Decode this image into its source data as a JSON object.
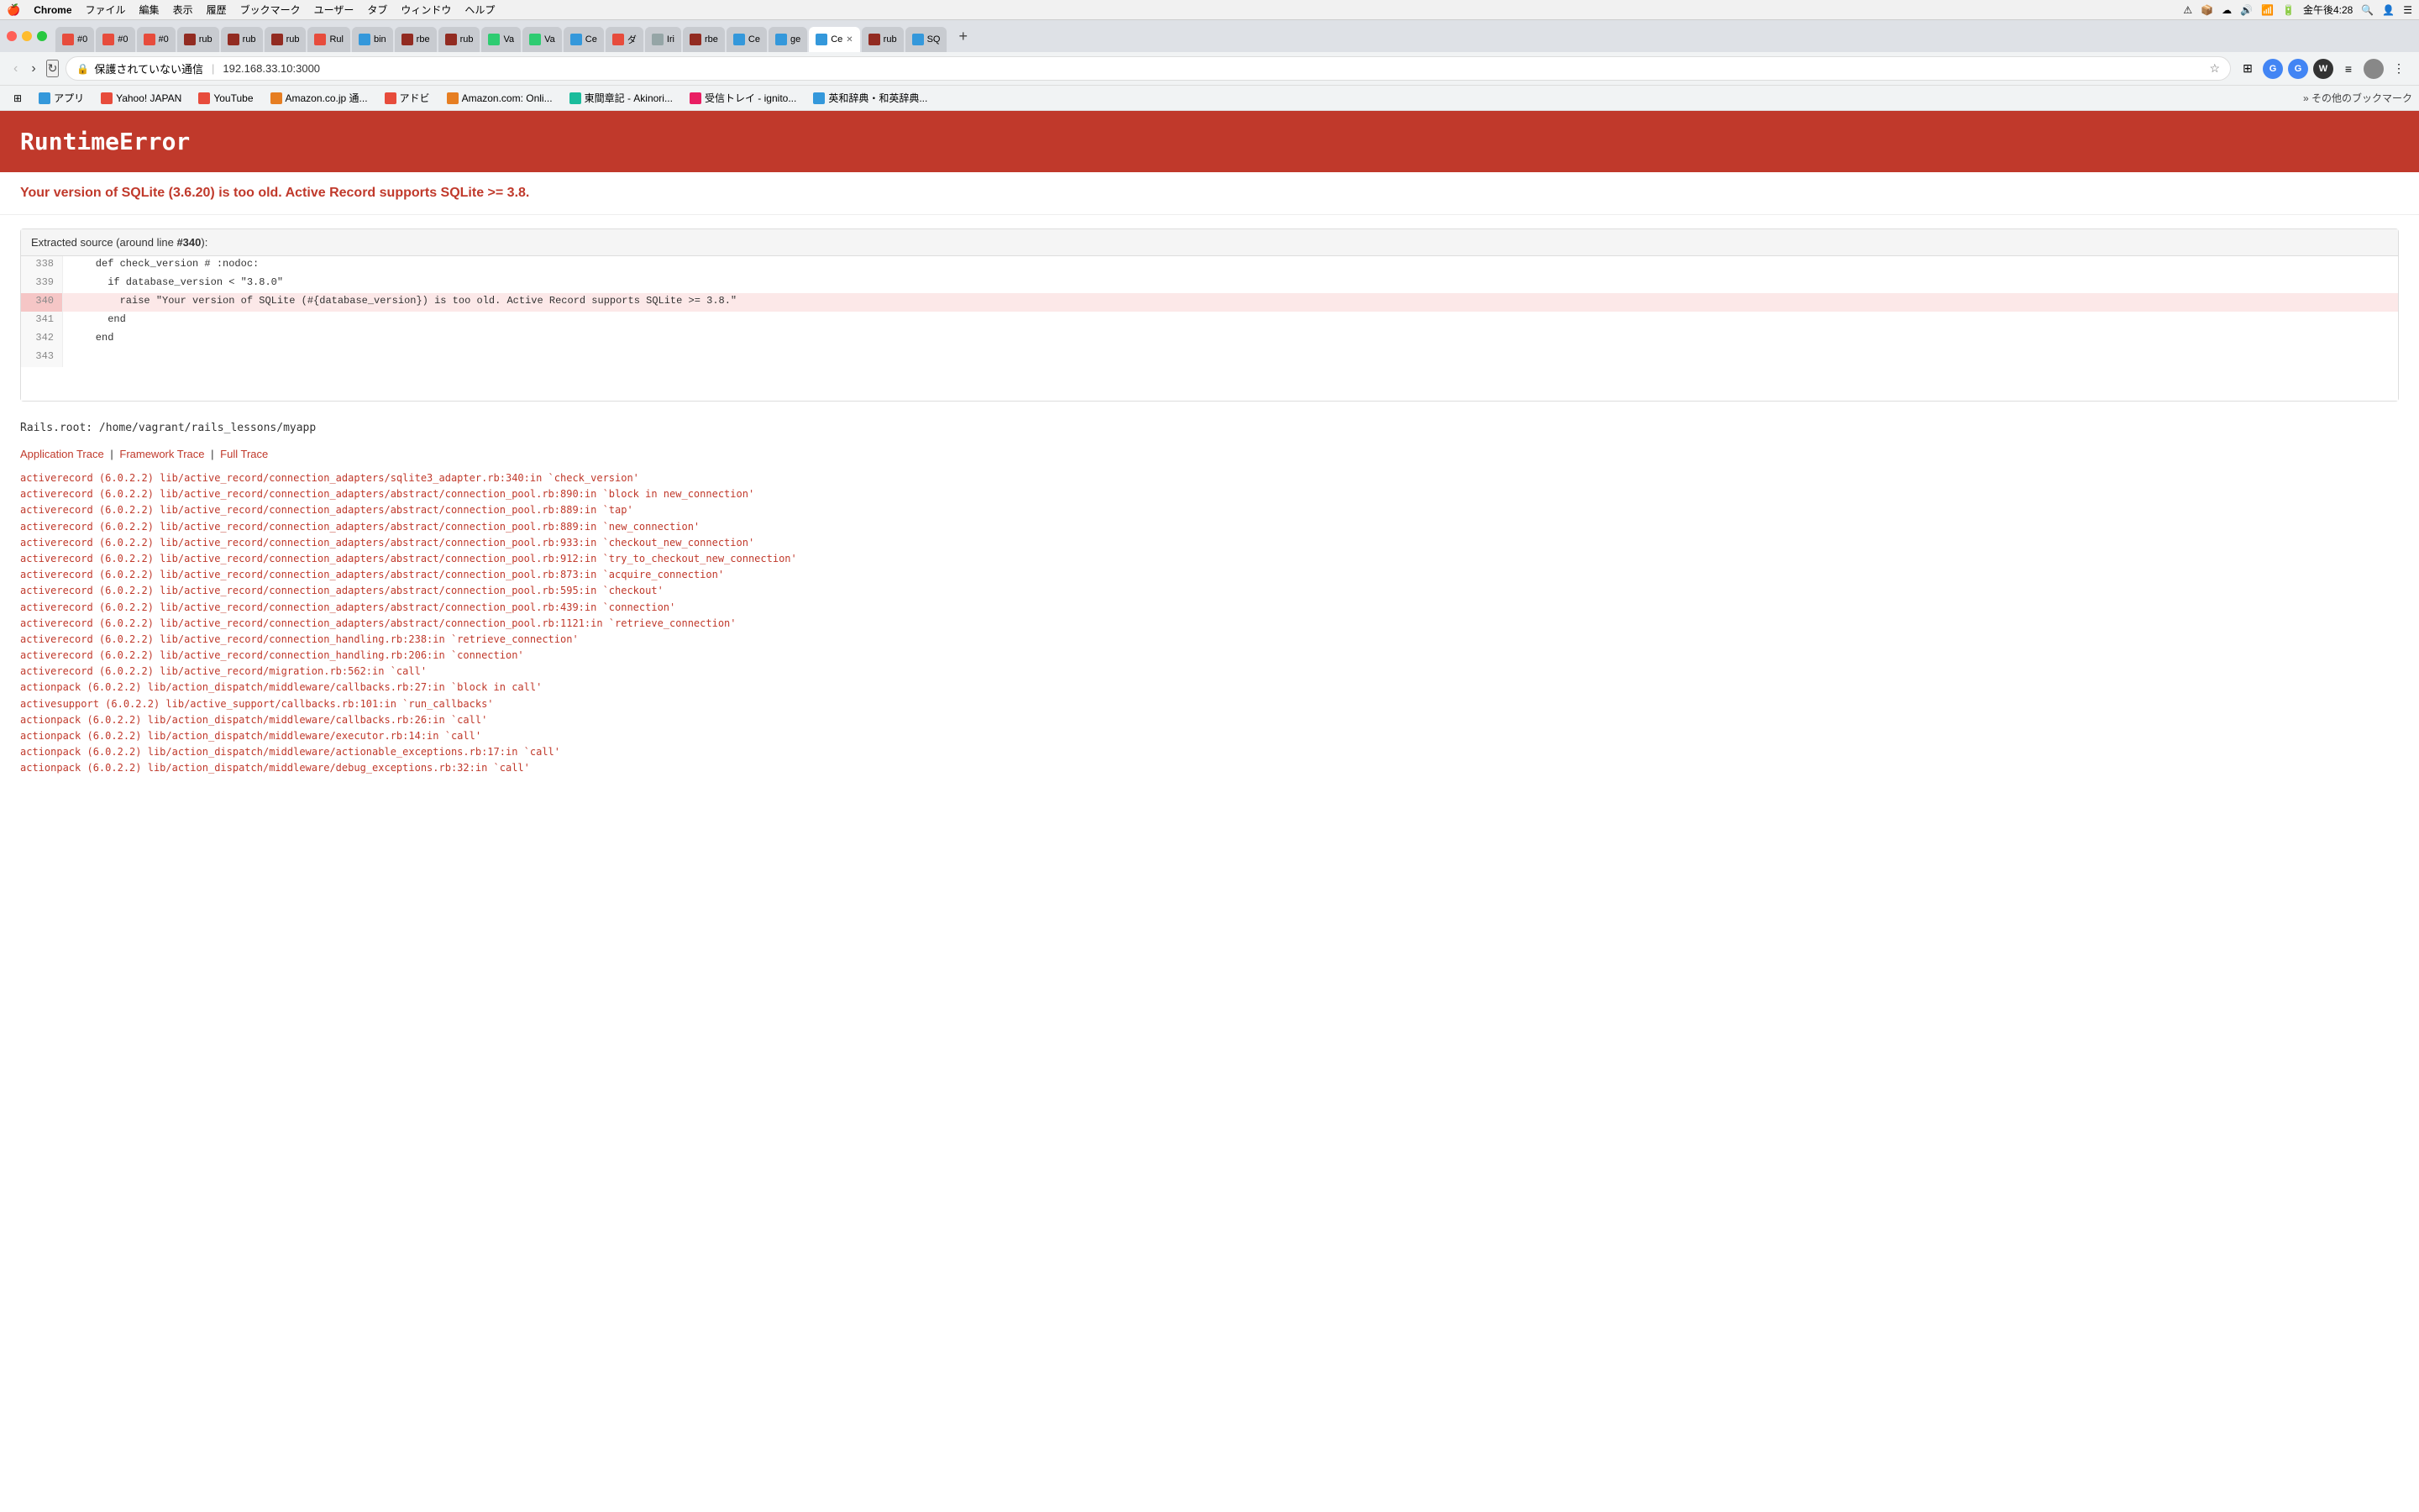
{
  "menubar": {
    "apple": "🍎",
    "items": [
      "Chrome",
      "ファイル",
      "編集",
      "表示",
      "履歴",
      "ブックマーク",
      "ユーザー",
      "タブ",
      "ウィンドウ",
      "ヘルプ"
    ],
    "right_items": [
      "⚠",
      "📦",
      "☁",
      "🔊",
      "📶",
      "🔋",
      "金午後4:28",
      "🔍",
      "👤",
      "☰"
    ]
  },
  "tabs": [
    {
      "label": "#0",
      "favicon_color": "red",
      "active": false
    },
    {
      "label": "#0",
      "favicon_color": "red",
      "active": false
    },
    {
      "label": "#0",
      "favicon_color": "red",
      "active": false
    },
    {
      "label": "rub",
      "favicon_color": "darkred",
      "active": false
    },
    {
      "label": "rub",
      "favicon_color": "darkred",
      "active": false
    },
    {
      "label": "rub",
      "favicon_color": "darkred",
      "active": false
    },
    {
      "label": "Rul",
      "favicon_color": "red",
      "active": false
    },
    {
      "label": "bin",
      "favicon_color": "blue",
      "active": false
    },
    {
      "label": "rbe",
      "favicon_color": "darkred",
      "active": false
    },
    {
      "label": "rub",
      "favicon_color": "darkred",
      "active": false
    },
    {
      "label": "Va",
      "favicon_color": "green",
      "active": false
    },
    {
      "label": "Va",
      "favicon_color": "green",
      "active": false
    },
    {
      "label": "Ce",
      "favicon_color": "blue",
      "active": false
    },
    {
      "label": "ダ",
      "favicon_color": "red",
      "active": false
    },
    {
      "label": "Iri",
      "favicon_color": "gray",
      "active": false
    },
    {
      "label": "rbe",
      "favicon_color": "darkred",
      "active": false
    },
    {
      "label": "Ce",
      "favicon_color": "blue",
      "active": false
    },
    {
      "label": "ge",
      "favicon_color": "blue",
      "active": false
    },
    {
      "label": "Ce",
      "favicon_color": "blue",
      "active": true
    },
    {
      "label": "rub",
      "favicon_color": "darkred",
      "active": false
    },
    {
      "label": "SQ",
      "favicon_color": "blue",
      "active": false
    }
  ],
  "address_bar": {
    "lock_label": "保護されていない通信",
    "url": "192.168.33.10:3000"
  },
  "bookmarks": [
    {
      "label": "アプリ",
      "favicon_color": "blue"
    },
    {
      "label": "Yahoo! JAPAN",
      "favicon_color": "red"
    },
    {
      "label": "YouTube",
      "favicon_color": "red"
    },
    {
      "label": "Amazon.co.jp 通...",
      "favicon_color": "orange"
    },
    {
      "label": "アドビ",
      "favicon_color": "red"
    },
    {
      "label": "Amazon.com: Onli...",
      "favicon_color": "orange"
    },
    {
      "label": "東間章記 - Akinori...",
      "favicon_color": "teal"
    },
    {
      "label": "受信トレイ - ignito...",
      "favicon_color": "pink"
    },
    {
      "label": "英和辞典・和英辞典...",
      "favicon_color": "blue"
    },
    {
      "label": "その他のブックマーク",
      "favicon_color": "gray"
    }
  ],
  "page": {
    "error_title": "RuntimeError",
    "error_message": "Your version of SQLite (3.6.20) is too old. Active Record supports SQLite >= 3.8.",
    "source_header_prefix": "Extracted source (around line ",
    "source_line_number": "#340",
    "source_header_suffix": "):",
    "code_lines": [
      {
        "num": "338",
        "code": "    def check_version # :nodoc:",
        "highlighted": false
      },
      {
        "num": "339",
        "code": "      if database_version < \"3.8.0\"",
        "highlighted": false
      },
      {
        "num": "340",
        "code": "        raise \"Your version of SQLite (#{database_version}) is too old. Active Record supports SQLite >= 3.8.\"",
        "highlighted": true
      },
      {
        "num": "341",
        "code": "      end",
        "highlighted": false
      },
      {
        "num": "342",
        "code": "    end",
        "highlighted": false
      },
      {
        "num": "343",
        "code": "",
        "highlighted": false
      }
    ],
    "rails_root": "Rails.root: /home/vagrant/rails_lessons/myapp",
    "trace_links": {
      "application": "Application Trace",
      "framework": "Framework Trace",
      "full": "Full Trace"
    },
    "trace_items": [
      "activerecord (6.0.2.2) lib/active_record/connection_adapters/sqlite3_adapter.rb:340:in `check_version'",
      "activerecord (6.0.2.2) lib/active_record/connection_adapters/abstract/connection_pool.rb:890:in `block in new_connection'",
      "activerecord (6.0.2.2) lib/active_record/connection_adapters/abstract/connection_pool.rb:889:in `tap'",
      "activerecord (6.0.2.2) lib/active_record/connection_adapters/abstract/connection_pool.rb:889:in `new_connection'",
      "activerecord (6.0.2.2) lib/active_record/connection_adapters/abstract/connection_pool.rb:933:in `checkout_new_connection'",
      "activerecord (6.0.2.2) lib/active_record/connection_adapters/abstract/connection_pool.rb:912:in `try_to_checkout_new_connection'",
      "activerecord (6.0.2.2) lib/active_record/connection_adapters/abstract/connection_pool.rb:873:in `acquire_connection'",
      "activerecord (6.0.2.2) lib/active_record/connection_adapters/abstract/connection_pool.rb:595:in `checkout'",
      "activerecord (6.0.2.2) lib/active_record/connection_adapters/abstract/connection_pool.rb:439:in `connection'",
      "activerecord (6.0.2.2) lib/active_record/connection_adapters/abstract/connection_pool.rb:1121:in `retrieve_connection'",
      "activerecord (6.0.2.2) lib/active_record/connection_handling.rb:238:in `retrieve_connection'",
      "activerecord (6.0.2.2) lib/active_record/connection_handling.rb:206:in `connection'",
      "activerecord (6.0.2.2) lib/active_record/migration.rb:562:in `call'",
      "actionpack (6.0.2.2) lib/action_dispatch/middleware/callbacks.rb:27:in `block in call'",
      "activesupport (6.0.2.2) lib/active_support/callbacks.rb:101:in `run_callbacks'",
      "actionpack (6.0.2.2) lib/action_dispatch/middleware/callbacks.rb:26:in `call'",
      "actionpack (6.0.2.2) lib/action_dispatch/middleware/executor.rb:14:in `call'",
      "actionpack (6.0.2.2) lib/action_dispatch/middleware/actionable_exceptions.rb:17:in `call'",
      "actionpack (6.0.2.2) lib/action_dispatch/middleware/debug_exceptions.rb:32:in `call'"
    ]
  }
}
